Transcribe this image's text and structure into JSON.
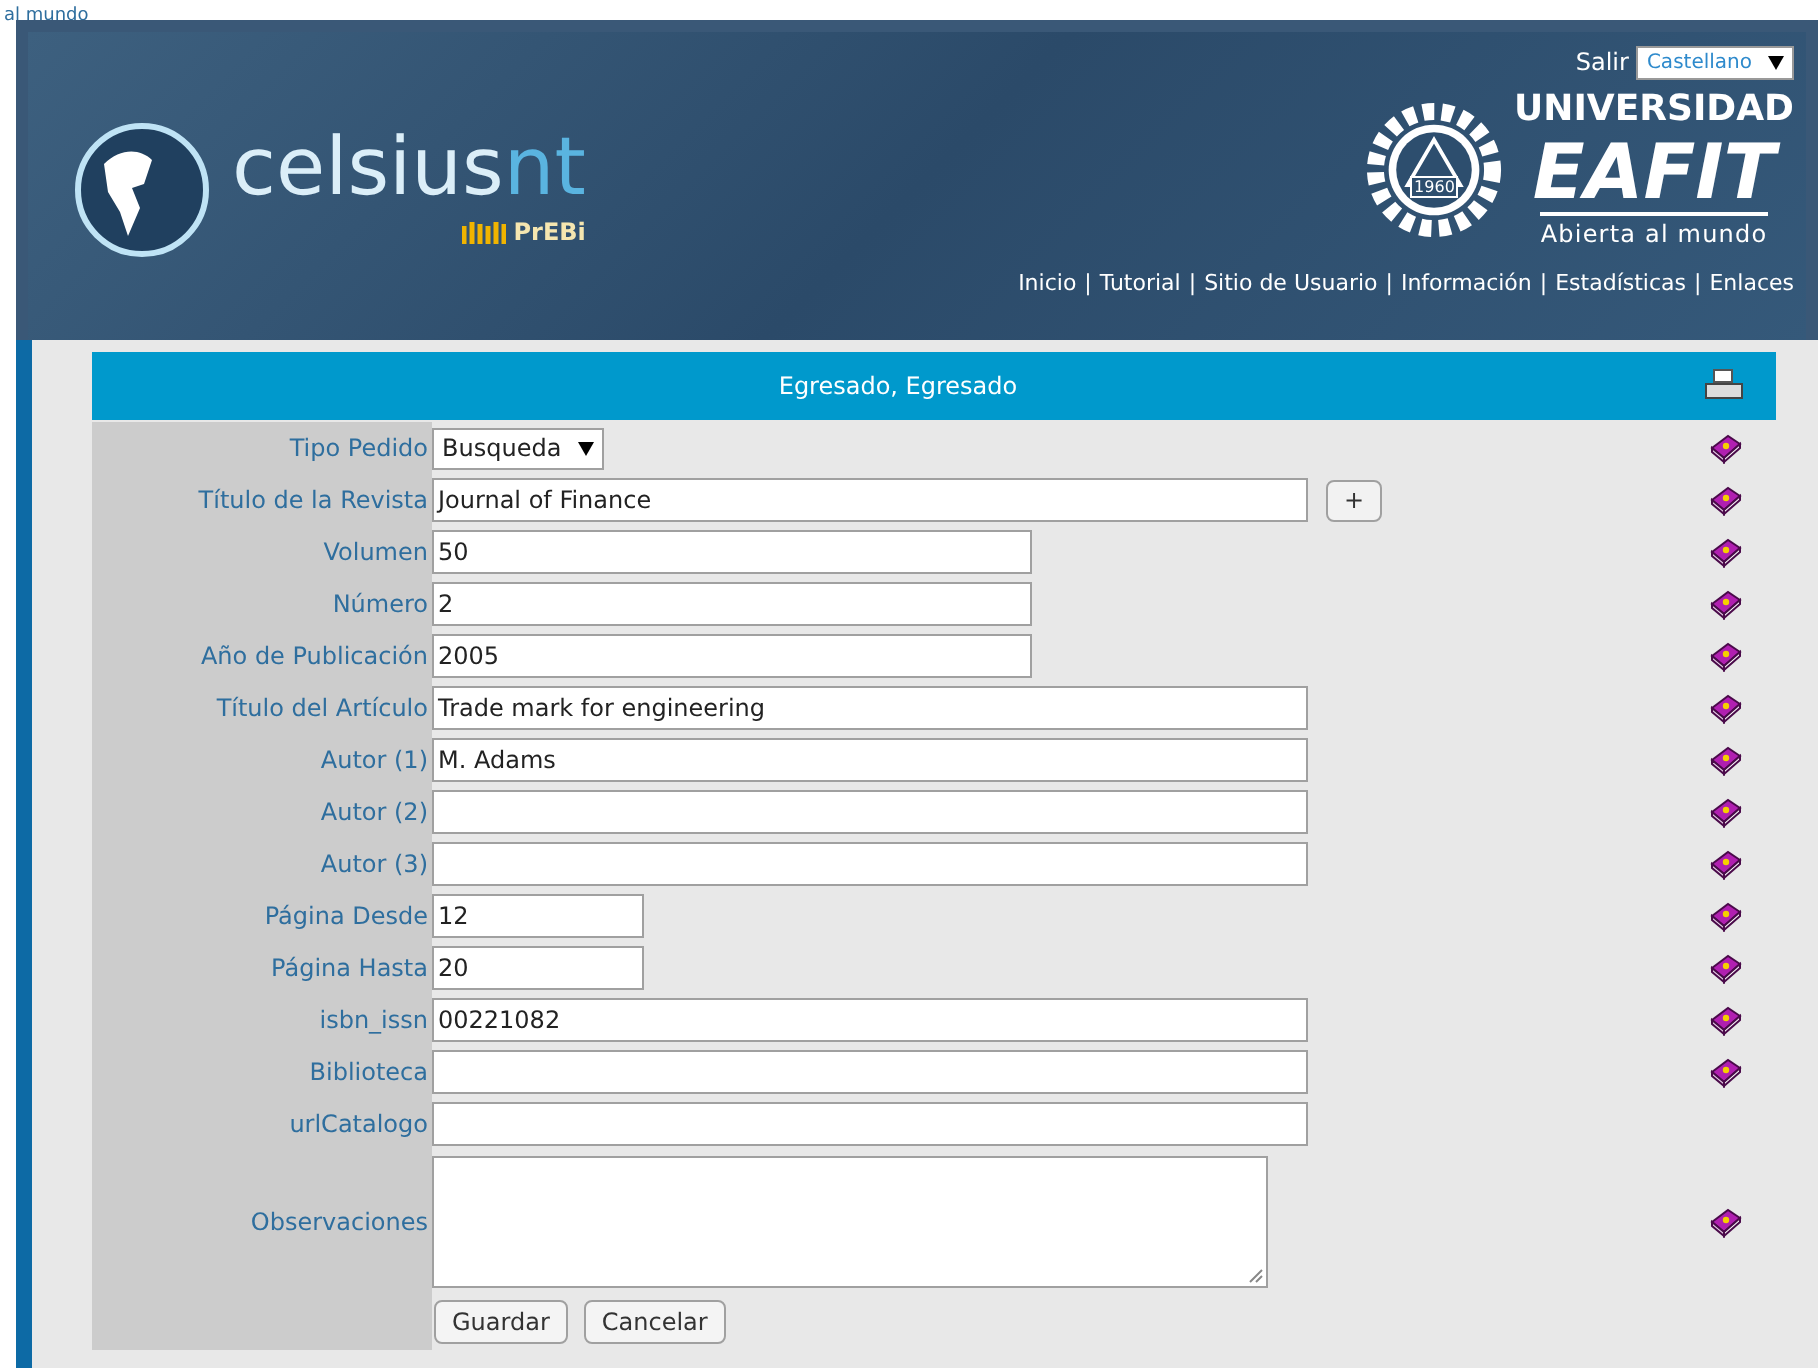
{
  "top_fragment": "al mundo",
  "header": {
    "logout": "Salir",
    "language": "Castellano",
    "brand": {
      "name_a": "celsius",
      "name_b": "nt",
      "sub": "PrEBi"
    },
    "university": {
      "line1": "UNIVERSIDAD",
      "line2": "EAFIT",
      "motto": "Abierta al mundo",
      "year": "1960"
    },
    "nav": [
      "Inicio",
      "Tutorial",
      "Sitio de Usuario",
      "Información",
      "Estadísticas",
      "Enlaces"
    ],
    "nav_separator": "|"
  },
  "form": {
    "title": "Egresado, Egresado",
    "fields": [
      {
        "label": "Tipo Pedido",
        "kind": "select",
        "value": "Busqueda",
        "help": true
      },
      {
        "label": "Título de la Revista",
        "kind": "long",
        "value": "Journal of Finance",
        "help": true,
        "add_button": "+"
      },
      {
        "label": "Volumen",
        "kind": "medium",
        "value": "50",
        "help": true
      },
      {
        "label": "Número",
        "kind": "medium",
        "value": "2",
        "help": true
      },
      {
        "label": "Año de Publicación",
        "kind": "medium",
        "value": "2005",
        "help": true
      },
      {
        "label": "Título del Artículo",
        "kind": "long",
        "value": "Trade mark for engineering",
        "help": true
      },
      {
        "label": "Autor (1)",
        "kind": "long",
        "value": "M. Adams",
        "help": true
      },
      {
        "label": "Autor (2)",
        "kind": "long",
        "help": true
      },
      {
        "label": "Autor (3)",
        "kind": "long",
        "help": true
      },
      {
        "label": "Página Desde",
        "kind": "short",
        "value": "12",
        "help": true
      },
      {
        "label": "Página Hasta",
        "kind": "short",
        "value": "20",
        "help": true
      },
      {
        "label": "isbn_issn",
        "kind": "long",
        "value": "00221082",
        "help": true
      },
      {
        "label": "Biblioteca",
        "kind": "long",
        "help": true
      },
      {
        "label": "urlCatalogo",
        "kind": "long",
        "help": false
      },
      {
        "label": "Observaciones",
        "kind": "textarea",
        "help": true
      }
    ],
    "buttons": [
      "Guardar",
      "Cancelar"
    ]
  }
}
